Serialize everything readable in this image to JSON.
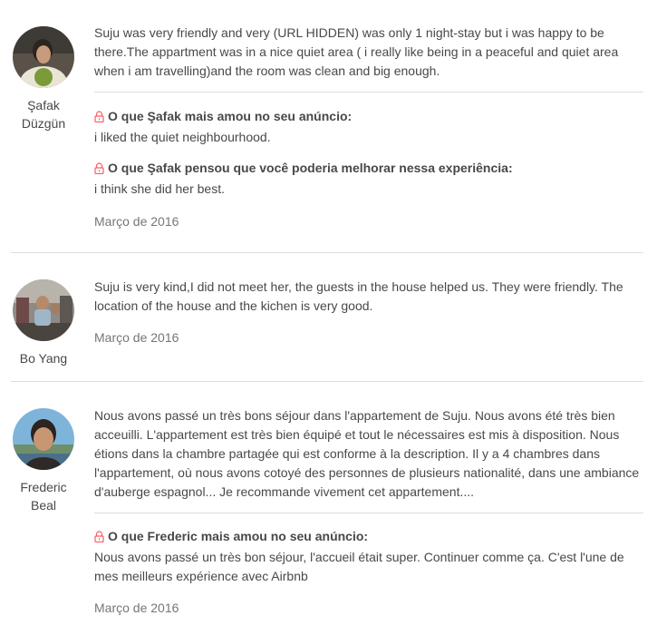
{
  "reviews": [
    {
      "author": "Şafak Düzgün",
      "author_line1": "Şafak",
      "author_line2": "Düzgün",
      "text": "Suju was very friendly and very (URL HIDDEN) was only 1 night-stay but i was happy to be there.The appartment was in a nice quiet area ( i really like being in a peaceful and quiet area when i am travelling)and the room was clean and big enough.",
      "private_feedback": [
        {
          "icon": "lock-icon",
          "heading": "O que Şafak mais amou no seu anúncio:",
          "text": "i liked the quiet neighbourhood."
        },
        {
          "icon": "lock-icon",
          "heading": "O que Şafak pensou que você poderia melhorar nessa experiência:",
          "text": "i think she did her best."
        }
      ],
      "date": "Março de 2016"
    },
    {
      "author": "Bo Yang",
      "text": "Suju is very kind,I did not meet her, the guests in the house helped us. They were friendly. The location of the house and the kichen is very good.",
      "date": "Março de 2016"
    },
    {
      "author": "Frederic Beal",
      "author_line1": "Frederic",
      "author_line2": "Beal",
      "text": "Nous avons passé un très bons séjour dans l'appartement de Suju. Nous avons été très bien acceuilli. L'appartement est très bien équipé et tout le nécessaires est mis à disposition. Nous étions dans la chambre partagée qui est conforme à la description. Il y a 4 chambres dans l'appartement, où nous avons cotoyé des personnes de plusieurs nationalité, dans une ambiance d'auberge espagnol... Je recommande vivement cet appartement....",
      "private_feedback": [
        {
          "icon": "lock-icon",
          "heading": "O que Frederic mais amou no seu anúncio:",
          "text": "Nous avons passé un très bon séjour, l'accueil était super. Continuer comme ça. C'est l'une de mes meilleurs expérience avec Airbnb"
        }
      ],
      "date": "Março de 2016"
    }
  ],
  "colors": {
    "text": "#484848",
    "muted": "#767676",
    "divider": "#dddddd",
    "lock": "#ff5a5f"
  }
}
